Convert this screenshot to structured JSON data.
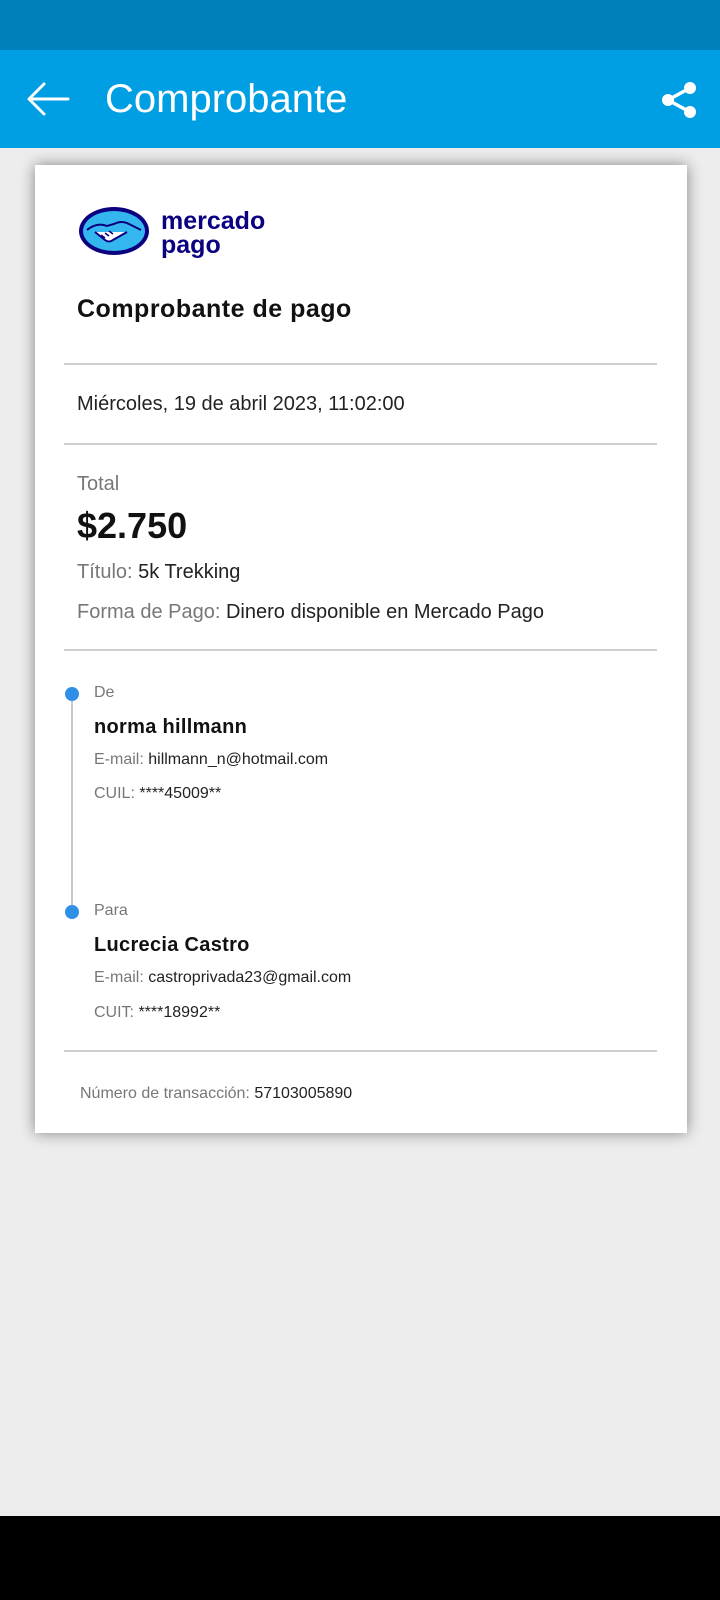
{
  "colors": {
    "status_bar": "#0080bb",
    "app_bar": "#009ee3",
    "background": "#ededed",
    "accent_dot": "#2f8fe7",
    "logo_navy": "#0a0080"
  },
  "app_bar": {
    "title": "Comprobante",
    "back_icon": "arrow-left-icon",
    "share_icon": "share-icon"
  },
  "receipt": {
    "logo_text_line1": "mercado",
    "logo_text_line2": "pago",
    "title": "Comprobante de pago",
    "date": "Miércoles, 19 de abril 2023, 11:02:00",
    "total_label": "Total",
    "total_value": "$2.750",
    "title_label": "Título:",
    "title_value": "5k Trekking",
    "payment_label": "Forma de Pago:",
    "payment_value": "Dinero disponible en Mercado Pago",
    "from": {
      "heading": "De",
      "name": "norma hillmann",
      "email_label": "E-mail:",
      "email": "hillmann_n@hotmail.com",
      "id_label": "CUIL:",
      "id_value": "****45009**"
    },
    "to": {
      "heading": "Para",
      "name": "Lucrecia Castro",
      "email_label": "E-mail:",
      "email": "castroprivada23@gmail.com",
      "id_label": "CUIT:",
      "id_value": "****18992**"
    },
    "transaction_label": "Número de transacción:",
    "transaction_value": "57103005890"
  }
}
